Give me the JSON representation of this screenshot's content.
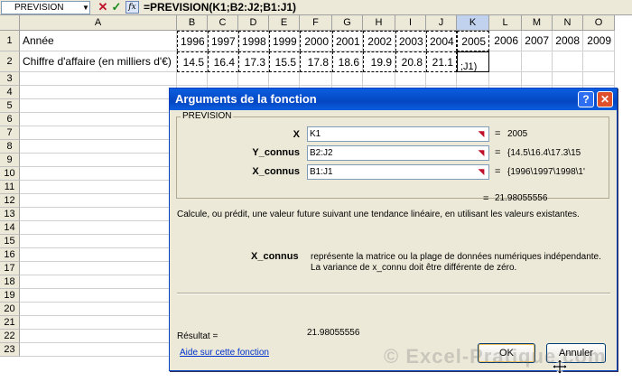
{
  "formula_bar": {
    "name_box": "PREVISION",
    "cancel_icon": "✕",
    "enter_icon": "✓",
    "fx_label": "fx",
    "formula": "=PREVISION(K1;B2:J2;B1:J1)"
  },
  "sheet": {
    "columns": [
      "A",
      "B",
      "C",
      "D",
      "E",
      "F",
      "G",
      "H",
      "I",
      "J",
      "K",
      "L",
      "M",
      "N",
      "O"
    ],
    "selected_column": "K",
    "rows": [
      "1",
      "2",
      "3",
      "4",
      "5",
      "6",
      "7",
      "8",
      "9",
      "10",
      "11",
      "12",
      "13",
      "14",
      "15",
      "16",
      "17",
      "18",
      "19",
      "20",
      "21",
      "22",
      "23"
    ],
    "row1": [
      "Année",
      "1996",
      "1997",
      "1998",
      "1999",
      "2000",
      "2001",
      "2002",
      "2003",
      "2004",
      "2005",
      "2006",
      "2007",
      "2008",
      "2009"
    ],
    "row2": [
      "Chiffre d'affaire (en milliers d'€)",
      "14.5",
      "16.4",
      "17.3",
      "15.5",
      "17.8",
      "18.6",
      "19.9",
      "20.8",
      "21.1",
      ";J1)",
      "",
      "",
      "",
      ""
    ]
  },
  "dialog": {
    "title": "Arguments de la fonction",
    "help_icon": "?",
    "close_icon": "✕",
    "group_label": "PREVISION",
    "args": [
      {
        "label": "X",
        "value": "K1",
        "result": "2005"
      },
      {
        "label": "Y_connus",
        "value": "B2:J2",
        "result": "{14.5\\16.4\\17.3\\15"
      },
      {
        "label": "X_connus",
        "value": "B1:J1",
        "result": "{1996\\1997\\1998\\1'"
      }
    ],
    "eq": "=",
    "result_top": "21.98055556",
    "description": "Calcule, ou prédit, une valeur future suivant une tendance linéaire, en utilisant les valeurs existantes.",
    "param_name": "X_connus",
    "param_desc_1": "représente la matrice ou la plage de données numériques indépendante.",
    "param_desc_2": "La variance de x_connu doit être différente de zéro.",
    "result_label": "Résultat =",
    "result_value": "21.98055556",
    "help_link": "Aide sur cette fonction",
    "ok_label": "OK",
    "cancel_label": "Annuler"
  },
  "watermark": "© Excel-Pratique.com"
}
